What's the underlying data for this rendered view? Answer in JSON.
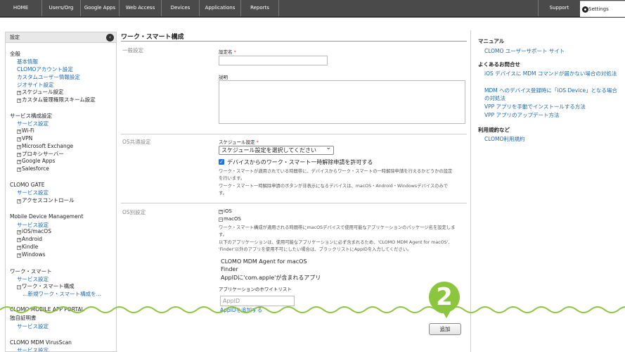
{
  "topnav": {
    "items": [
      "HOME",
      "Users/Org",
      "Google Apps",
      "Web Access",
      "Devices",
      "Applications",
      "Reports"
    ],
    "support": "Support",
    "settings": "Settings"
  },
  "sidebar": {
    "header": "設定",
    "groups": [
      {
        "title": "全般",
        "items": [
          "基本情報",
          "CLOMOアカウント設定",
          "カスタムユーザー情報設定",
          "ジオサイト設定"
        ],
        "trees": [
          "スケジュール設定",
          "カスタム管理権限スキーム設定"
        ]
      },
      {
        "title": "サービス構成設定",
        "link": "サービス設定",
        "trees": [
          "Wi-Fi",
          "VPN",
          "Microsoft Exchange",
          "プロキシサーバー",
          "Google Apps",
          "Salesforce"
        ]
      },
      {
        "title": "CLOMO GATE",
        "link": "サービス設定",
        "trees": [
          "アクセスコントロール"
        ]
      },
      {
        "title": "Mobile Device Management",
        "link": "サービス設定",
        "trees": [
          "iOS/macOS",
          "Android",
          "Kindle",
          "Windows"
        ]
      },
      {
        "title": "ワーク・スマート",
        "link": "サービス設定",
        "trees": [
          "ワーク・スマート構成"
        ],
        "sublink": "…新規ワーク・スマート構成を…"
      },
      {
        "title": "CLOMO MOBILE APP PORTAL",
        "title2": "独自証明書",
        "link": "サービス設定"
      },
      {
        "title": "CLOMO MDM VirusScan",
        "link": "サービス設定"
      }
    ]
  },
  "main": {
    "title": "ワーク・スマート構成",
    "general": {
      "section": "一般設定",
      "name_label": "設定名",
      "desc_label": "説明"
    },
    "os_common": {
      "section": "OS共通設定",
      "schedule_label": "スケジュール設定",
      "schedule_value": "スケジュール設定を選択してください",
      "allow_label": "デバイスからのワーク・スマート一時解除申請を許可する",
      "allow_desc1": "ワーク・スマートが適用されている時間帯に、デバイスからワーク・スマートの一時解除申請を行えるかどうかの設定",
      "allow_desc2": "を行います。",
      "allow_desc3": "ワーク・スマート一時解除申請のボタンが非表示になるデバイスは、macOS・Android・Windowsデバイスのみで",
      "allow_desc4": "す。"
    },
    "os_specific": {
      "section": "OS別設定",
      "ios": "iOS",
      "macos": "macOS",
      "desc1": "ワーク・スマート構成が適用される時間帯にmacOSデバイスで使用可能なアプリケーションのパッケージ名を設定しま",
      "desc2": "す。",
      "desc3": "以下のアプリケーションは、使用可能なアプリケーションに必ず含まれるため、'CLOMO MDM Agent for macOS',",
      "desc4": "'Finder'以外のアプリを使用不可にしたい場合は、ブラックリストにAppIDを入力してください。",
      "apps": [
        "CLOMO MDM Agent for macOS",
        "Finder",
        "AppIDに'com.apple'が含まれるアプリ"
      ],
      "whitelist_label": "アプリケーションのホワイトリスト",
      "appid_placeholder": "AppID",
      "add_app_link": "AppIDを追加する"
    },
    "add_button": "追加"
  },
  "right": {
    "manual_head": "マニュアル",
    "manual_link": "CLOMO ユーザーサポート サイト",
    "faq_head": "よくあるお問合せ",
    "faq_links": [
      "iOS デバイスに MDM コマンドが届かない場合の対処法",
      "MDM へのデバイス登録時に「iOS Device」となる場合の対処法",
      "VPP アプリを手動でインストールする方法",
      "VPP アプリのアップデート方法"
    ],
    "terms_head": "利用規約など",
    "terms_link": "CLOMO利用規約"
  },
  "callout": "2",
  "colors": {
    "accent": "#8cc63f",
    "link": "#1967b3",
    "topbar": "#4a4a4a"
  }
}
